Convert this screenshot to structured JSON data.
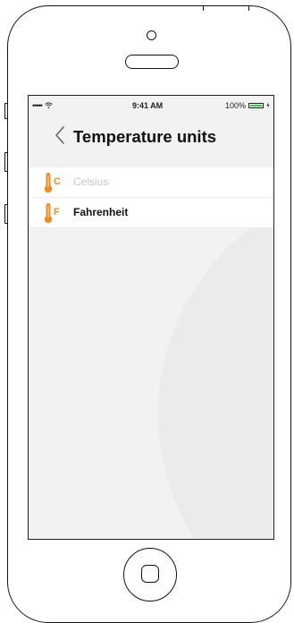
{
  "status_bar": {
    "signal": "•••••",
    "time": "9:41 AM",
    "battery_percent": "100%",
    "battery_level": 1.0
  },
  "nav": {
    "back_icon": "chevron-left-icon",
    "title": "Temperature units"
  },
  "units": [
    {
      "unit_letter": "C",
      "label": "Celsius",
      "selected": false,
      "icon": "thermometer-icon"
    },
    {
      "unit_letter": "F",
      "label": "Fahrenheit",
      "selected": true,
      "icon": "thermometer-icon"
    }
  ],
  "colors": {
    "accent": "#f08a24",
    "battery_green": "#2ecc40",
    "inactive_text": "#c8c8c8"
  }
}
